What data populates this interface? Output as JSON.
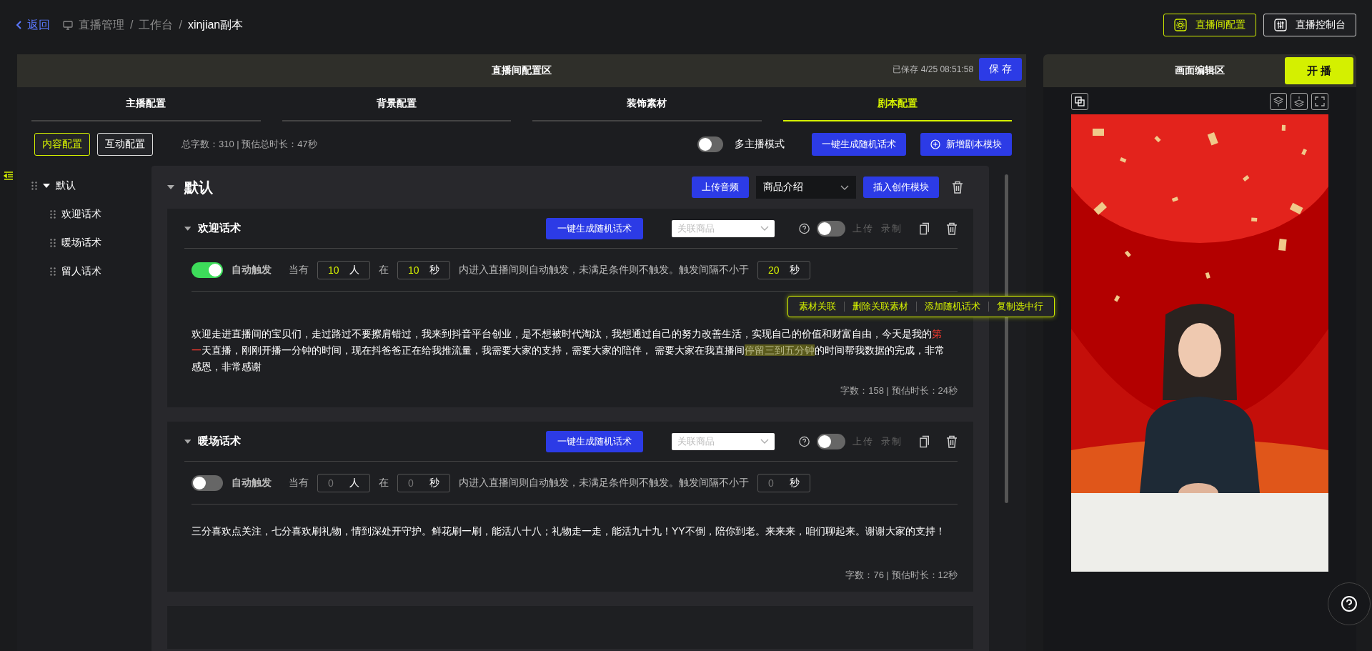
{
  "breadcrumb": {
    "back": "返回",
    "path": [
      "直播管理",
      "工作台"
    ],
    "separator": "/",
    "current": "xinjian副本"
  },
  "top_buttons": [
    {
      "label": "直播间配置",
      "kind": "room"
    },
    {
      "label": "直播控制台",
      "kind": "console"
    }
  ],
  "config_panel": {
    "title": "直播间配置区",
    "saved": "已保存 4/25 08:51:58",
    "save": "保 存",
    "tabs": [
      {
        "label": "主播配置",
        "selected": false
      },
      {
        "label": "背景配置",
        "selected": false
      },
      {
        "label": "装饰素材",
        "selected": false
      },
      {
        "label": "剧本配置",
        "selected": true
      }
    ],
    "subtabs": [
      {
        "label": "内容配置",
        "selected": true
      },
      {
        "label": "互动配置",
        "selected": false
      }
    ],
    "stats": "总字数：310 | 预估总时长：47秒",
    "multi_host": {
      "label": "多主播模式",
      "on": false
    },
    "generate": "一键生成随机话术",
    "add_module": "新增剧本模块"
  },
  "tree": [
    {
      "label": "默认",
      "expanded": true,
      "children": [
        {
          "label": "欢迎话术"
        },
        {
          "label": "暖场话术"
        },
        {
          "label": "留人话术"
        }
      ]
    }
  ],
  "group": {
    "title": "默认",
    "expanded": true,
    "upload": "上传音频",
    "select": "商品介绍",
    "insert": "插入创作模块"
  },
  "scripts": [
    {
      "title": "欢迎话术",
      "generate": "一键生成随机话术",
      "product_placeholder": "关联商品",
      "audio_on": false,
      "upload": "上传",
      "record": "录制",
      "auto_label": "自动触发",
      "auto_on": true,
      "when": "当有",
      "people": "10",
      "people_unit": "人",
      "at": "在",
      "seconds": "10",
      "seconds_unit": "秒",
      "rule": "内进入直播间则自动触发，未满足条件则不触发。触发间隔不小于",
      "interval": "20",
      "interval_unit": "秒",
      "text": [
        {
          "kind": "plain",
          "text": "欢迎走进直播间的宝贝们，走过路过不要擦肩错过，我来到抖音平台创业，是不想被时代淘汰，我想通过自己的努力改善生活，实现自己的价值和财富自由，今天是我的"
        },
        {
          "kind": "marked",
          "text": "第一"
        },
        {
          "kind": "plain",
          "text": "天直播，刚刚开播一分钟的时间，现在抖爸爸正在给我推流量，我需要大家的支持，需要大家的陪伴， 需要大家在我直播间"
        },
        {
          "kind": "selected",
          "text": "停留三到五分钟"
        },
        {
          "kind": "plain",
          "text": "的时间帮我数据的完成，非常感恩，非常感谢"
        }
      ],
      "menu": [
        "素材关联",
        "删除关联素材",
        "添加随机话术",
        "复制选中行"
      ],
      "stats": "字数：158 | 预估时长：24秒"
    },
    {
      "title": "暖场话术",
      "generate": "一键生成随机话术",
      "product_placeholder": "关联商品",
      "audio_on": false,
      "upload": "上传",
      "record": "录制",
      "auto_label": "自动触发",
      "auto_on": false,
      "when": "当有",
      "people": "0",
      "people_unit": "人",
      "at": "在",
      "seconds": "0",
      "seconds_unit": "秒",
      "rule": "内进入直播间则自动触发，未满足条件则不触发。触发间隔不小于",
      "interval": "0",
      "interval_unit": "秒",
      "text": [
        {
          "kind": "plain",
          "text": "三分喜欢点关注，七分喜欢刷礼物，情到深处开守护。鲜花刷一刷，能活八十八；礼物走一走，能活九十九！YY不倒，陪你到老。来来来，咱们聊起来。谢谢大家的支持！"
        }
      ],
      "stats": "字数：76 | 预估时长：12秒"
    }
  ],
  "preview_panel": {
    "title": "画面编辑区",
    "start": "开 播"
  }
}
